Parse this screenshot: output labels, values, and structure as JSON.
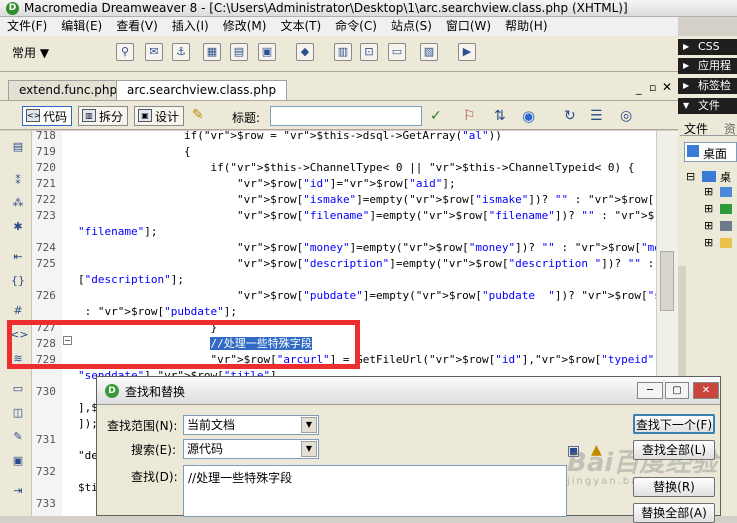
{
  "window": {
    "title": "Macromedia Dreamweaver 8 - [C:\\Users\\Administrator\\Desktop\\1\\arc.searchview.class.php (XHTML)]"
  },
  "menu": [
    "文件(F)",
    "编辑(E)",
    "查看(V)",
    "插入(I)",
    "修改(M)",
    "文本(T)",
    "命令(C)",
    "站点(S)",
    "窗口(W)",
    "帮助(H)"
  ],
  "toolbar": {
    "category": "常用"
  },
  "tabs": [
    {
      "label": "extend.func.php",
      "active": false
    },
    {
      "label": "arc.searchview.class.php",
      "active": true
    }
  ],
  "viewbar": {
    "code_label": "代码",
    "split_label": "拆分",
    "design_label": "设计",
    "title_label": "标题:",
    "title_value": ""
  },
  "right_panel": {
    "sections": [
      "CSS",
      "应用程",
      "标签检",
      "文件"
    ],
    "file_tabs": [
      "文件",
      "资"
    ],
    "location": "桌面",
    "tree_root": "桌"
  },
  "code_lines": [
    {
      "num": "718",
      "text": "                if($row = $this->dsql->GetArray(\"al\"))"
    },
    {
      "num": "719",
      "text": "                {"
    },
    {
      "num": "720",
      "text": "                    if($this->ChannelType< 0 || $this->ChannelTypeid< 0) {"
    },
    {
      "num": "721",
      "text": "                        $row[\"id\"]=$row[\"aid\"];"
    },
    {
      "num": "722",
      "text": "                        $row[\"ismake\"]=empty($row[\"ismake\"])? \"\" : $row[\"ismake\"];"
    },
    {
      "num": "723",
      "text": "                        $row[\"filename\"]=empty($row[\"filename\"])? \"\" : $row["
    },
    {
      "num": "",
      "text": "\"filename\"];"
    },
    {
      "num": "724",
      "text": "                        $row[\"money\"]=empty($row[\"money\"])? \"\" : $row[\"money\"];"
    },
    {
      "num": "725",
      "text": "                        $row[\"description\"]=empty($row[\"description \"])? \"\" : $row"
    },
    {
      "num": "",
      "text": "[\"description\"];"
    },
    {
      "num": "726",
      "text": "                        $row[\"pubdate\"]=empty($row[\"pubdate  \"])? $row[\"senddate\"]"
    },
    {
      "num": "",
      "text": " : $row[\"pubdate\"];"
    },
    {
      "num": "727",
      "text": "                    }"
    },
    {
      "num": "728",
      "text": "                    //处理一些特殊字段"
    },
    {
      "num": "729",
      "text": "                    $row[\"arcurl\"] = GetFileUrl($row[\"id\"],$row[\"typeid\"],$row["
    },
    {
      "num": "",
      "text": "\"senddate\"],$row[\"title\"],"
    },
    {
      "num": "730",
      "text": ""
    },
    {
      "num": "",
      "text": "],$"
    },
    {
      "num": "",
      "text": "]);"
    },
    {
      "num": "731",
      "text": ""
    },
    {
      "num": "",
      "text": "\"de"
    },
    {
      "num": "732",
      "text": ""
    },
    {
      "num": "",
      "text": "$ti"
    },
    {
      "num": "733",
      "text": ""
    }
  ],
  "dialog": {
    "title": "查找和替换",
    "scope_label": "查找范围(N):",
    "scope_value": "当前文档",
    "search_label": "搜索(E):",
    "search_value": "源代码",
    "find_label": "查找(D):",
    "find_value": "//处理一些特殊字段",
    "buttons": {
      "find_next": "查找下一个(F)",
      "find_all": "查找全部(L)",
      "replace": "替换(R)",
      "replace_all": "替换全部(A)"
    },
    "watermark": "Bai百度经验",
    "watermark_sub": "jingyan.baidu.com"
  }
}
